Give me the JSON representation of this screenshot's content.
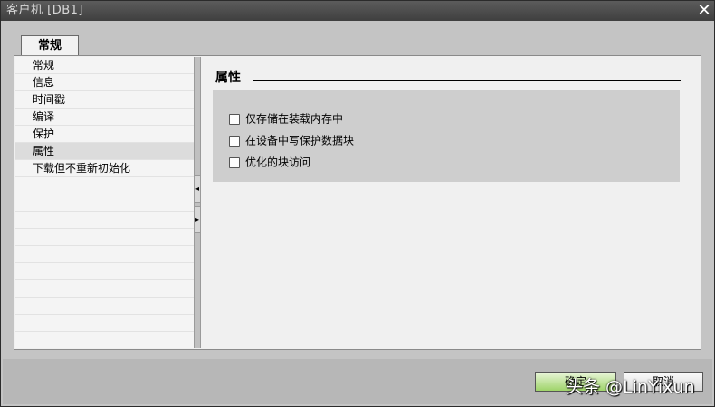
{
  "window": {
    "title": "客户机 [DB1]",
    "close_glyph": "✕"
  },
  "tabs": [
    {
      "label": "常规"
    }
  ],
  "nav": {
    "items": [
      {
        "label": "常规"
      },
      {
        "label": "信息"
      },
      {
        "label": "时间戳"
      },
      {
        "label": "编译"
      },
      {
        "label": "保护"
      },
      {
        "label": "属性"
      },
      {
        "label": "下载但不重新初始化"
      }
    ],
    "selected": "属性"
  },
  "splitter": {
    "collapse_glyph": "◂",
    "expand_glyph": "▸"
  },
  "section": {
    "title": "属性",
    "options": [
      {
        "label": "仅存储在装载内存中",
        "checked": false
      },
      {
        "label": "在设备中写保护数据块",
        "checked": false
      },
      {
        "label": "优化的块访问",
        "checked": false
      }
    ]
  },
  "buttons": {
    "ok_label": "确定",
    "cancel_label": "取消"
  },
  "watermark": "头条 @LinYixun"
}
